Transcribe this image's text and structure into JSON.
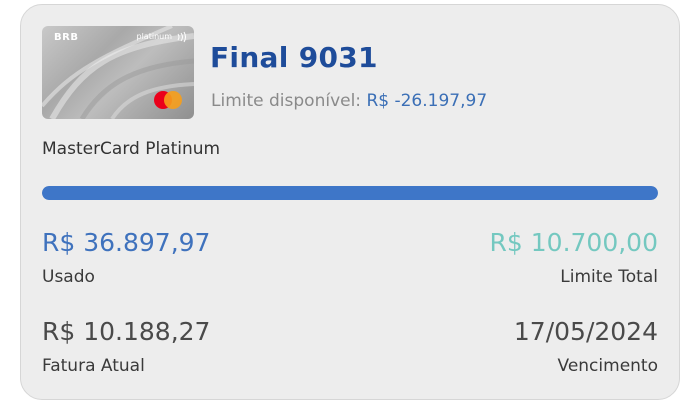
{
  "card": {
    "image": {
      "brand_text": "BRB",
      "tier_text": "platinum",
      "icons": [
        "contactless-icon",
        "mastercard-logo"
      ]
    },
    "title": "Final 9031",
    "limit_label": "Limite disponível:",
    "limit_value": "R$ -26.197,97",
    "name": "MasterCard Platinum",
    "usage_fraction": 1.0,
    "used": {
      "value": "R$ 36.897,97",
      "label": "Usado"
    },
    "total_limit": {
      "value": "R$ 10.700,00",
      "label": "Limite Total"
    },
    "invoice": {
      "value": "R$ 10.188,27",
      "label": "Fatura Atual"
    },
    "due": {
      "value": "17/05/2024",
      "label": "Vencimento"
    }
  },
  "colors": {
    "title": "#1e4c9a",
    "limit_value": "#3b6fb6",
    "progress": "#3e76c8",
    "used": "#3f72bd",
    "total": "#74c8c0",
    "panel_bg": "#ededed"
  }
}
